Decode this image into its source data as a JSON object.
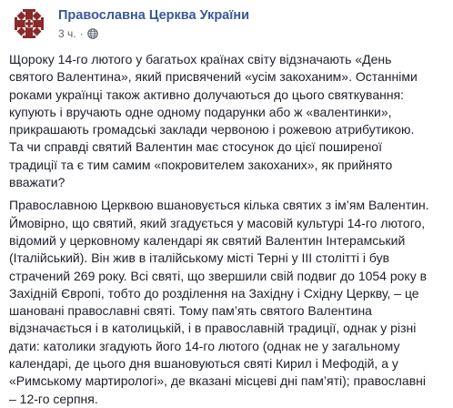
{
  "post": {
    "author": "Православна Церква України",
    "time": "3 ч.",
    "separator": "·",
    "avatar_icon": "ocu-cross-emblem-icon",
    "privacy_icon": "globe-icon",
    "colors": {
      "link": "#385898",
      "text": "#1d2129",
      "meta": "#606770",
      "emblem": "#8b2a2a"
    },
    "paragraphs": [
      "Щороку 14-го лютого у багатьох країнах світу відзначають «День святого Валентина», який присвячений «усім закоханим». Останніми роками українці також активно долучаються до цього святкування: купують і вручають одне одному подарунки або ж «валентинки», прикрашають громадські заклади червоною і рожевою атрибутикою. Та чи справді святий Валентин має стосунок до цієї поширеної традиції та є тим самим «покровителем закоханих», як прийнято вважати?",
      "Православною Церквою вшановується кілька святих з ім’ям Валентин. Ймовірно, що святий, який згадується у масовій культурі 14-го лютого, відомий у церковному календарі як святий Валентин Інтерамський (Італійський). Він жив в італійському місті Терні у III столітті і був страчений 269 року. Всі святі, що звершили свій подвиг до 1054 року в Західній Європі, тобто до розділення на Західну і Східну Церкву, – це шановані православні святі. Тому пам’ять святого Валентина відзначається і в католицькій, і в православній традиції, однак у різні дати: католики згадують його 14-го лютого (однак не у загальному календарі, де цього дня вшановуються святі Кирил і Мефодій, а у «Римському мартирологі», де вказані місцеві дні пам’яті); православні – 12-го серпня."
    ]
  }
}
